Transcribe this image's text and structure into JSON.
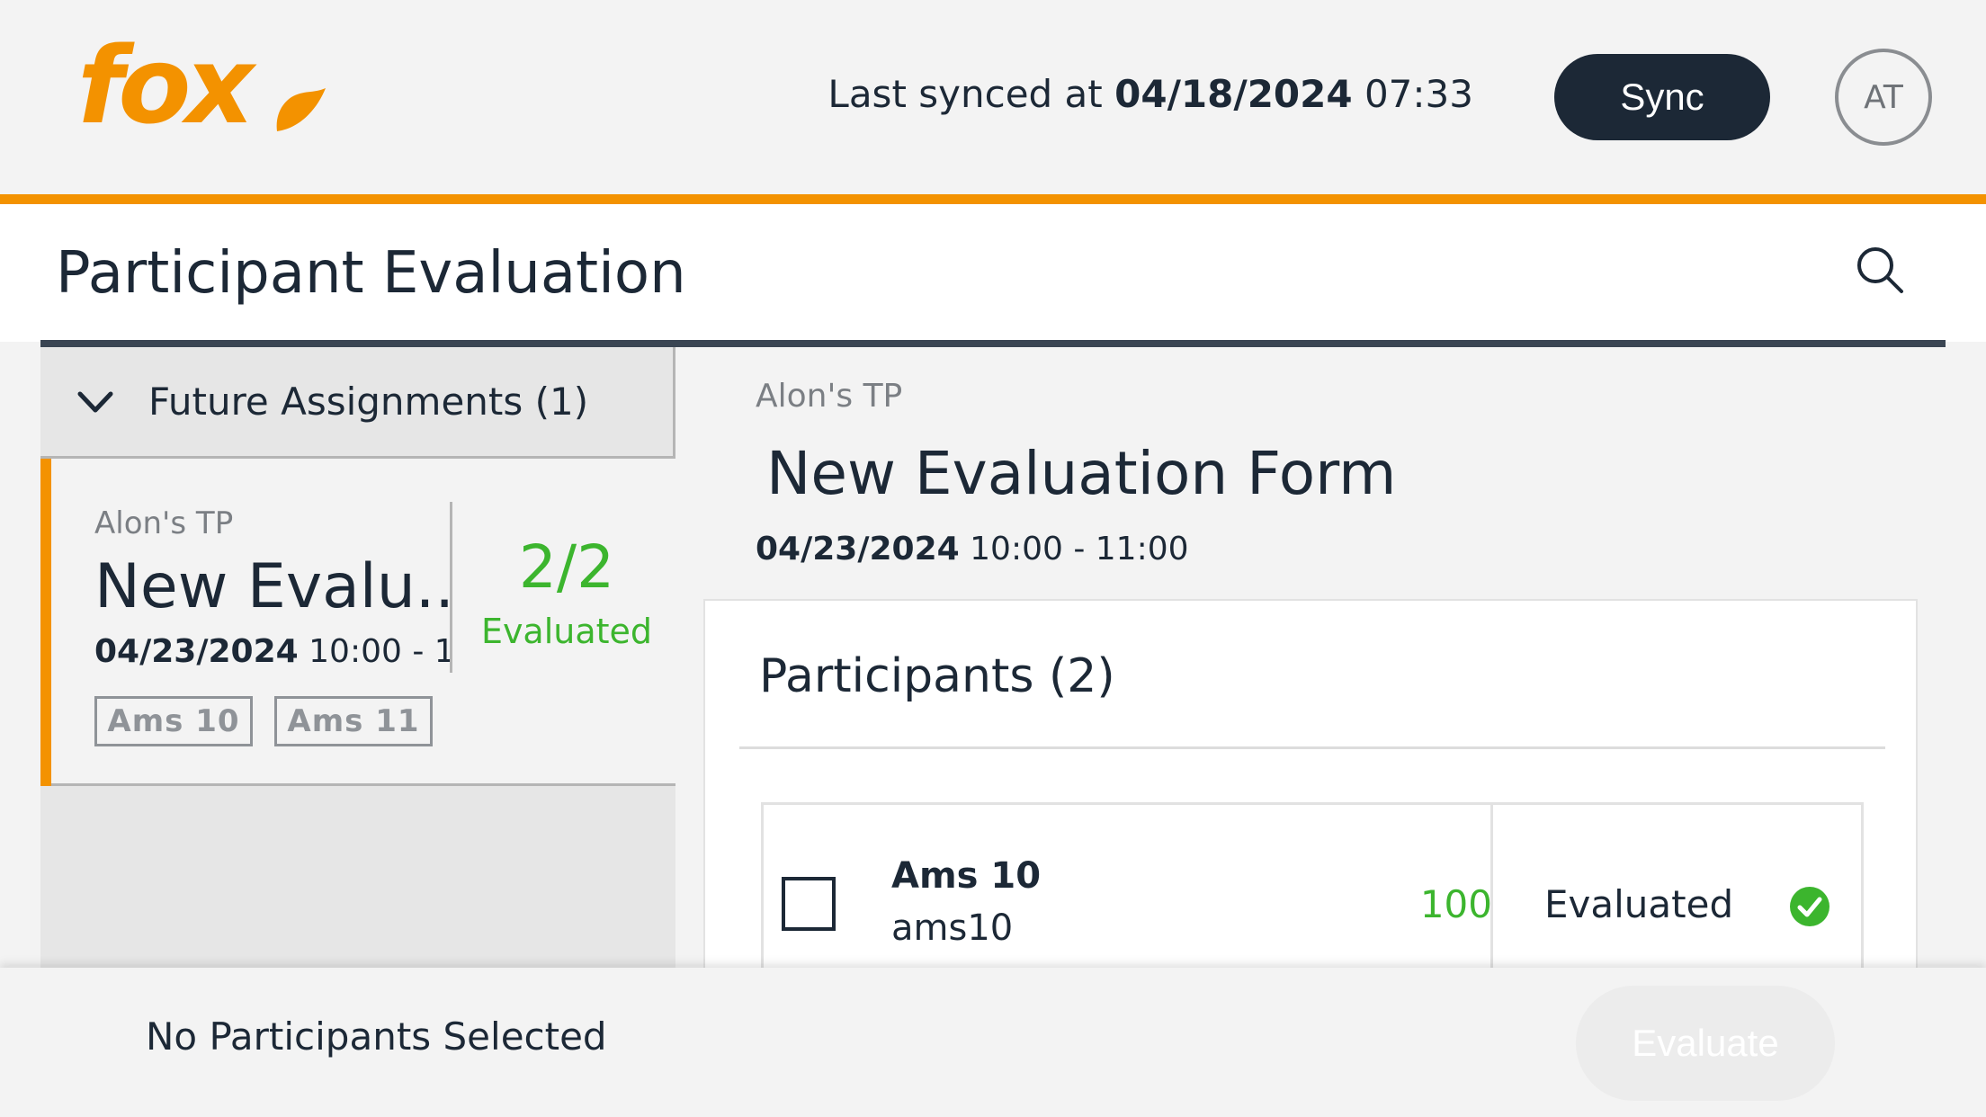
{
  "header": {
    "brand": "fox",
    "sync_prefix": "Last synced at",
    "sync_date": "04/18/2024",
    "sync_time": "07:33",
    "sync_button": "Sync",
    "avatar_initials": "AT"
  },
  "page": {
    "title": "Participant Evaluation"
  },
  "sidebar": {
    "section_label": "Future Assignments (1)",
    "card": {
      "subtitle": "Alon's TP",
      "title": "New Evalu...",
      "date": "04/23/2024",
      "time": "10:00 - 1...",
      "count": "2/2",
      "status": "Evaluated",
      "tags": [
        "Ams 10",
        "Ams 11"
      ]
    }
  },
  "detail": {
    "subtitle": "Alon's TP",
    "title": "New Evaluation Form",
    "date": "04/23/2024",
    "time": "10:00 - 11:00",
    "participants_title": "Participants (2)",
    "participants": [
      {
        "name": "Ams 10",
        "id": "ams10",
        "score": "100",
        "status": "Evaluated"
      }
    ]
  },
  "footer": {
    "selection_text": "No Participants Selected",
    "evaluate_button": "Evaluate"
  },
  "colors": {
    "accent": "#f39200",
    "dark": "#1c2836",
    "success": "#3cb52e"
  }
}
